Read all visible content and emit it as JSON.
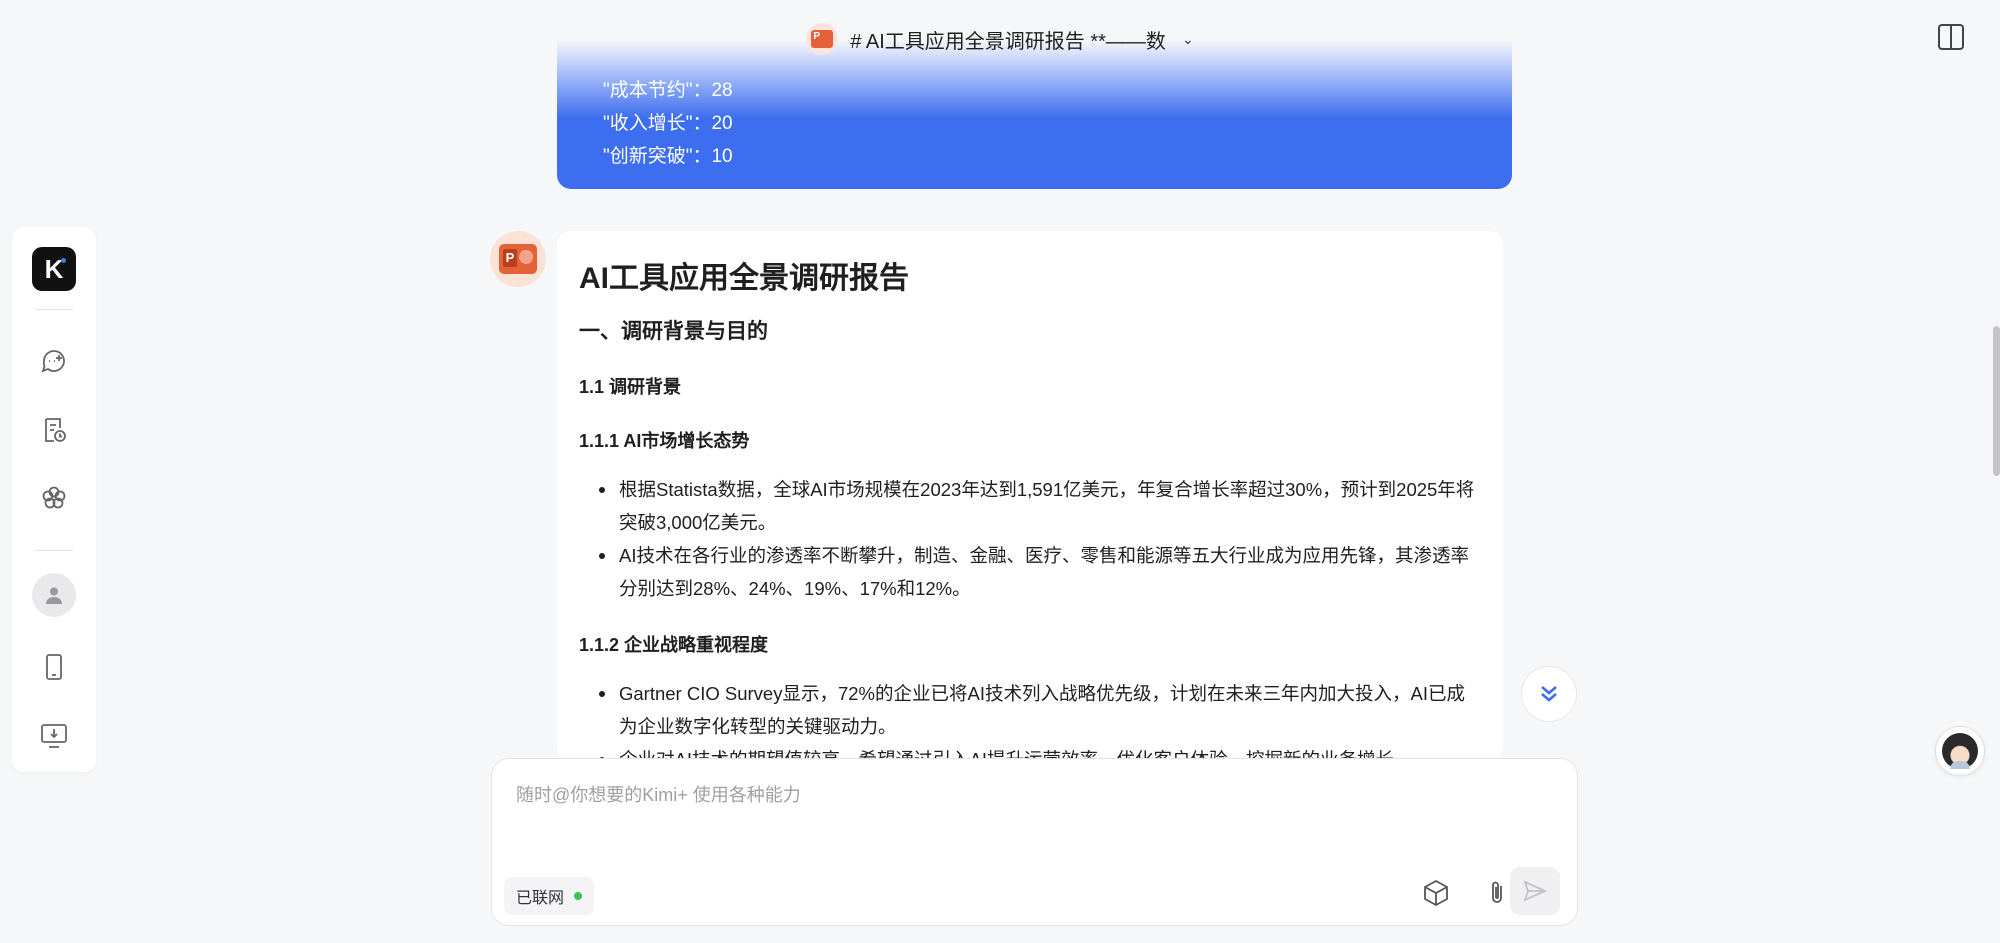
{
  "header": {
    "title": "# AI工具应用全景调研报告 **——数",
    "icon": "ppt-icon"
  },
  "user_message": {
    "lines": [
      "\"成本节约\"：28",
      "\"收入增长\"：20",
      "\"创新突破\"：10"
    ]
  },
  "report": {
    "title": "AI工具应用全景调研报告",
    "section1": "一、调研背景与目的",
    "sub1_1": "1.1 调研背景",
    "sub1_1_1": "1.1.1 AI市场增长态势",
    "bullets1": [
      "根据Statista数据，全球AI市场规模在2023年达到1,591亿美元，年复合增长率超过30%，预计到2025年将突破3,000亿美元。",
      "AI技术在各行业的渗透率不断攀升，制造、金融、医疗、零售和能源等五大行业成为应用先锋，其渗透率分别达到28%、24%、19%、17%和12%。"
    ],
    "sub1_1_2": "1.1.2 企业战略重视程度",
    "bullets2": [
      "Gartner CIO Survey显示，72%的企业已将AI技术列入战略优先级，计划在未来三年内加大投入，AI已成为企业数字化转型的关键驱动力。",
      "企业对AI技术的期望值较高，希望通过引入AI提升运营效率、优化客户体验、挖掘新的业务增长"
    ]
  },
  "input": {
    "placeholder": "随时@你想要的Kimi+ 使用各种能力",
    "net_status": "已联网"
  },
  "sidebar": {
    "logo": "K"
  },
  "colors": {
    "accent": "#3d6ef0",
    "ppt": "#e4613a",
    "online": "#3ec25a"
  }
}
